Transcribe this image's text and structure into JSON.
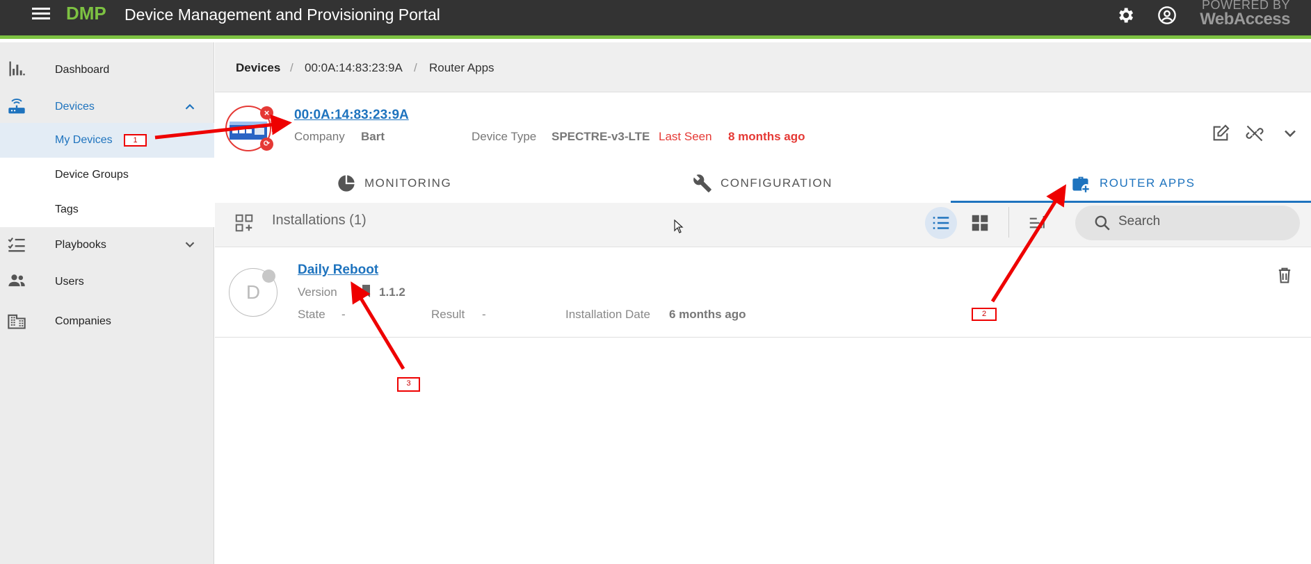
{
  "app": {
    "brand": "DMP",
    "title": "Device Management and Provisioning Portal",
    "powered_line1": "POWERED BY",
    "powered_line2": "WebAccess"
  },
  "sidebar": {
    "items": [
      {
        "label": "Dashboard",
        "icon": "bar-chart-icon"
      },
      {
        "label": "Devices",
        "icon": "router-icon",
        "expanded": true
      },
      {
        "label": "Playbooks",
        "icon": "checklist-icon"
      },
      {
        "label": "Users",
        "icon": "users-icon"
      },
      {
        "label": "Companies",
        "icon": "building-icon"
      }
    ],
    "subitems": [
      {
        "label": "My Devices",
        "active": true
      },
      {
        "label": "Device Groups"
      },
      {
        "label": "Tags"
      }
    ]
  },
  "breadcrumb": {
    "items": [
      "Devices",
      "00:0A:14:83:23:9A",
      "Router Apps"
    ],
    "separator": "/"
  },
  "device": {
    "mac": "00:0A:14:83:23:9A",
    "company_label": "Company",
    "company_value": "Bart",
    "type_label": "Device Type",
    "type_value": "SPECTRE-v3-LTE",
    "last_seen_label": "Last Seen",
    "last_seen_value": "8 months ago",
    "status_color": "#e53935"
  },
  "tabs": [
    {
      "label": "MONITORING",
      "icon": "pie-chart-icon"
    },
    {
      "label": "CONFIGURATION",
      "icon": "wrench-icon"
    },
    {
      "label": "ROUTER APPS",
      "icon": "briefcase-plus-icon",
      "active": true
    }
  ],
  "toolbar": {
    "title": "Installations (1)",
    "search_placeholder": "Search"
  },
  "installations": [
    {
      "avatar_letter": "D",
      "name": "Daily Reboot",
      "version_label": "Version",
      "version_value": "1.1.2",
      "state_label": "State",
      "state_value": "-",
      "result_label": "Result",
      "result_value": "-",
      "install_date_label": "Installation Date",
      "install_date_value": "6 months ago"
    }
  ],
  "annotations": [
    "1",
    "2",
    "3"
  ],
  "colors": {
    "accent": "#1e73be",
    "brand_green": "#7dc242",
    "topbar": "#333333",
    "alert_red": "#e53935"
  }
}
